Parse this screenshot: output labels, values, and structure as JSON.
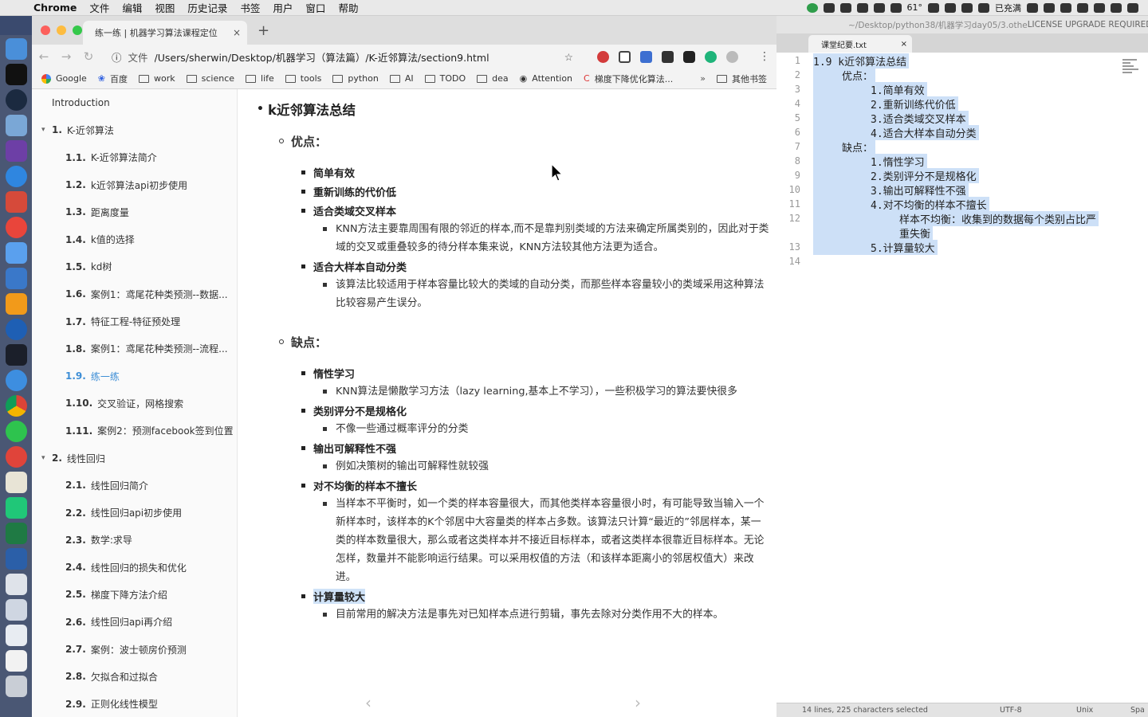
{
  "menubar": {
    "app": "Chrome",
    "menus": [
      "文件",
      "编辑",
      "视图",
      "历史记录",
      "书签",
      "用户",
      "窗口",
      "帮助"
    ],
    "status_items": [
      "61°",
      "已充满"
    ]
  },
  "browser": {
    "tab_title": "练一练 | 机器学习算法课程定位",
    "tab_close": "×",
    "new_tab": "+",
    "omnibox_label": "文件",
    "url": "/Users/sherwin/Desktop/机器学习（算法篇）/K-近邻算法/section9.html",
    "bookmarks": [
      "Google",
      "百度",
      "work",
      "science",
      "life",
      "tools",
      "python",
      "AI",
      "TODO",
      "dea",
      "Attention",
      "梯度下降优化算法..."
    ],
    "bookmarks_overflow": "»",
    "other_bookmarks": "其他书签"
  },
  "sidebar": {
    "intro": "Introduction",
    "items": [
      {
        "num": "1.",
        "label": "K-近邻算法",
        "kind": "chapter"
      },
      {
        "num": "1.1.",
        "label": "K-近邻算法简介",
        "kind": "sub"
      },
      {
        "num": "1.2.",
        "label": "k近邻算法api初步使用",
        "kind": "sub"
      },
      {
        "num": "1.3.",
        "label": "距离度量",
        "kind": "sub"
      },
      {
        "num": "1.4.",
        "label": "k值的选择",
        "kind": "sub"
      },
      {
        "num": "1.5.",
        "label": "kd树",
        "kind": "sub"
      },
      {
        "num": "1.6.",
        "label": "案例1：鸢尾花种类预测--数据...",
        "kind": "sub"
      },
      {
        "num": "1.7.",
        "label": "特征工程-特征预处理",
        "kind": "sub"
      },
      {
        "num": "1.8.",
        "label": "案例1：鸢尾花种类预测--流程...",
        "kind": "sub"
      },
      {
        "num": "1.9.",
        "label": "练一练",
        "kind": "sub",
        "active": true
      },
      {
        "num": "1.10.",
        "label": "交叉验证，网格搜索",
        "kind": "sub"
      },
      {
        "num": "1.11.",
        "label": "案例2：预测facebook签到位置",
        "kind": "sub"
      },
      {
        "num": "2.",
        "label": "线性回归",
        "kind": "chapter"
      },
      {
        "num": "2.1.",
        "label": "线性回归简介",
        "kind": "sub"
      },
      {
        "num": "2.2.",
        "label": "线性回归api初步使用",
        "kind": "sub"
      },
      {
        "num": "2.3.",
        "label": "数学:求导",
        "kind": "sub"
      },
      {
        "num": "2.4.",
        "label": "线性回归的损失和优化",
        "kind": "sub"
      },
      {
        "num": "2.5.",
        "label": "梯度下降方法介绍",
        "kind": "sub"
      },
      {
        "num": "2.6.",
        "label": "线性回归api再介绍",
        "kind": "sub"
      },
      {
        "num": "2.7.",
        "label": "案例：波士顿房价预测",
        "kind": "sub"
      },
      {
        "num": "2.8.",
        "label": "欠拟合和过拟合",
        "kind": "sub"
      },
      {
        "num": "2.9.",
        "label": "正则化线性模型",
        "kind": "sub"
      }
    ]
  },
  "article": {
    "title": "k近邻算法总结",
    "pros_heading": "优点：",
    "pros": [
      {
        "title": "简单有效"
      },
      {
        "title": "重新训练的代价低"
      },
      {
        "title": "适合类域交叉样本",
        "desc": "KNN方法主要靠周围有限的邻近的样本,而不是靠判别类域的方法来确定所属类别的，因此对于类域的交叉或重叠较多的待分样本集来说，KNN方法较其他方法更为适合。"
      },
      {
        "title": "适合大样本自动分类",
        "desc": "该算法比较适用于样本容量比较大的类域的自动分类，而那些样本容量较小的类域采用这种算法比较容易产生误分。"
      }
    ],
    "cons_heading": "缺点：",
    "cons": [
      {
        "title": "惰性学习",
        "desc": "KNN算法是懒散学习方法（lazy learning,基本上不学习），一些积极学习的算法要快很多"
      },
      {
        "title": "类别评分不是规格化",
        "desc": "不像一些通过概率评分的分类"
      },
      {
        "title": "输出可解释性不强",
        "desc": "例如决策树的输出可解释性就较强"
      },
      {
        "title": "对不均衡的样本不擅长",
        "desc": "当样本不平衡时，如一个类的样本容量很大，而其他类样本容量很小时，有可能导致当输入一个新样本时，该样本的K个邻居中大容量类的样本占多数。该算法只计算“最近的”邻居样本，某一类的样本数量很大，那么或者这类样本并不接近目标样本，或者这类样本很靠近目标样本。无论怎样，数量并不能影响运行结果。可以采用权值的方法（和该样本距离小的邻居权值大）来改进。"
      },
      {
        "title": "计算量较大",
        "desc": "目前常用的解决方法是事先对已知样本点进行剪辑，事先去除对分类作用不大的样本。",
        "highlight": true
      }
    ],
    "prev": "‹",
    "next": "›"
  },
  "editor": {
    "path": "~/Desktop/python38/机器学习day05/3.othe",
    "license": "LICENSE UPGRADE REQUIRED",
    "tab": "课堂纪要.txt",
    "tab_close": "×",
    "lines": [
      {
        "n": "1",
        "text": "1.9 k近邻算法总结",
        "indent": 0
      },
      {
        "n": "2",
        "text": "优点：",
        "indent": 1
      },
      {
        "n": "3",
        "text": "1.简单有效",
        "indent": 2
      },
      {
        "n": "4",
        "text": "2.重新训练代价低",
        "indent": 2
      },
      {
        "n": "5",
        "text": "3.适合类域交叉样本",
        "indent": 2
      },
      {
        "n": "6",
        "text": "4.适合大样本自动分类",
        "indent": 2
      },
      {
        "n": "7",
        "text": "缺点：",
        "indent": 1
      },
      {
        "n": "8",
        "text": "1.惰性学习",
        "indent": 2
      },
      {
        "n": "9",
        "text": "2.类别评分不是规格化",
        "indent": 2
      },
      {
        "n": "10",
        "text": "3.输出可解释性不强",
        "indent": 2
      },
      {
        "n": "11",
        "text": "4.对不均衡的样本不擅长",
        "indent": 2
      },
      {
        "n": "12",
        "text": "样本不均衡：收集到的数据每个类别占比严",
        "indent": 3
      },
      {
        "n": "",
        "text": "重失衡",
        "indent": 3
      },
      {
        "n": "13",
        "text": "5.计算量较大",
        "indent": 2
      },
      {
        "n": "14",
        "text": "",
        "indent": 0
      }
    ],
    "status": {
      "selection": "14 lines, 225 characters selected",
      "encoding": "UTF-8",
      "line_endings": "Unix",
      "syntax": "Spa"
    }
  }
}
